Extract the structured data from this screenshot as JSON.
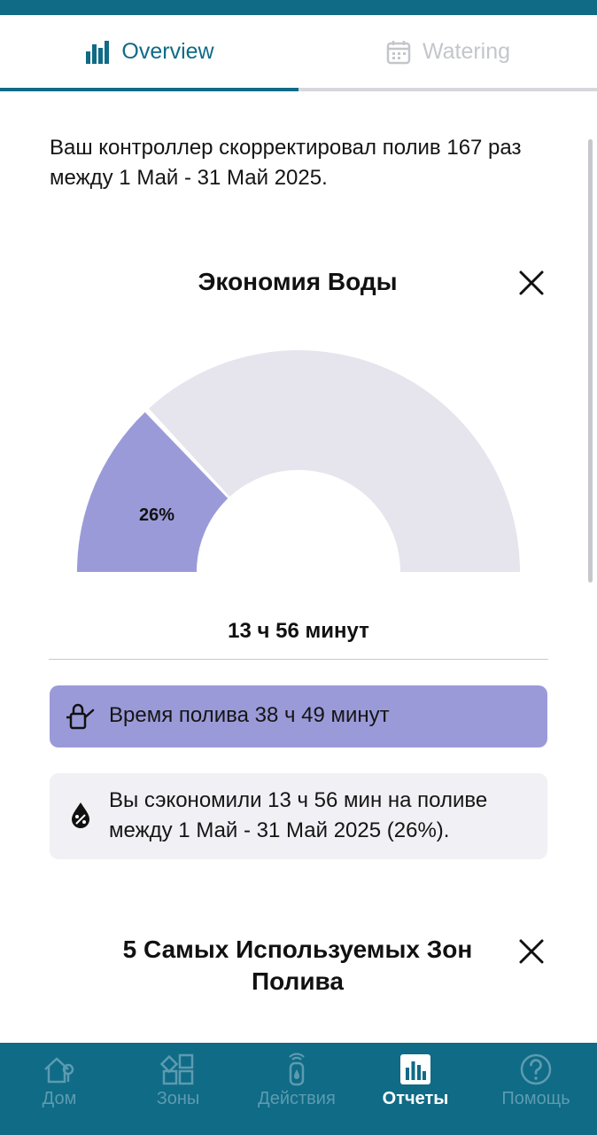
{
  "tabs": {
    "overview_label": "Overview",
    "watering_label": "Watering",
    "active": "overview"
  },
  "summary_text": "Ваш контроллер скорректировал полив 167 раз между 1 Май - 31 Май 2025.",
  "water_savings": {
    "title": "Экономия Воды",
    "percent_label": "26%",
    "saved_time": "13 ч 56 минут",
    "watering_time_text": "Время полива 38 ч 49 минут",
    "saved_text_line1": "Вы сэкономили 13 ч 56 мин на поливе",
    "saved_text_line2": "между 1 Май - 31 Май 2025 (26%).",
    "chart_data": {
      "type": "pie",
      "categories": [
        "saved",
        "remaining"
      ],
      "values": [
        26,
        74
      ],
      "colors": [
        "#9b9ad9",
        "#e6e5ed"
      ]
    }
  },
  "top_zones": {
    "title_line1": "5 Самых Используемых Зон",
    "title_line2": "Полива"
  },
  "bottom_nav": {
    "items": [
      {
        "label": "Дом",
        "icon": "home-icon"
      },
      {
        "label": "Зоны",
        "icon": "zones-icon"
      },
      {
        "label": "Действия",
        "icon": "controller-icon"
      },
      {
        "label": "Отчеты",
        "icon": "reports-icon"
      },
      {
        "label": "Помощь",
        "icon": "help-icon"
      }
    ],
    "active_index": 3
  },
  "colors": {
    "brand": "#0f6b86",
    "accent_purple": "#9b9ad9",
    "gauge_track": "#e6e5ed",
    "inactive_nav": "#5d9bb0"
  }
}
